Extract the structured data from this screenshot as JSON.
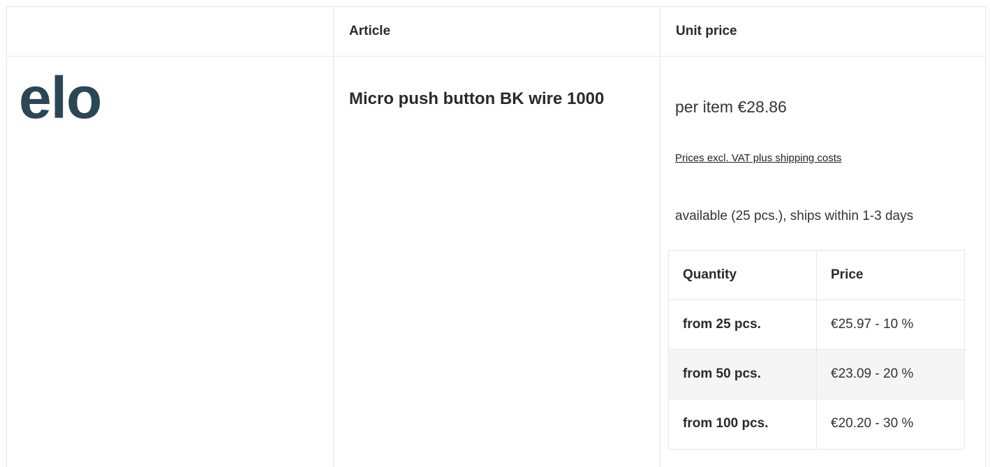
{
  "table": {
    "headers": {
      "logo_col": "",
      "article": "Article",
      "unit_price": "Unit price"
    }
  },
  "row": {
    "brand_logo": "elo",
    "product_name": "Micro push button BK wire 1000",
    "price_line": "per item €28.86",
    "vat_link": "Prices excl. VAT plus shipping costs",
    "availability": "available (25 pcs.), ships within 1-3 days"
  },
  "tiers": {
    "header": {
      "quantity": "Quantity",
      "price": "Price"
    },
    "rows": [
      {
        "quantity": "from 25 pcs.",
        "price": "€25.97 - 10 %"
      },
      {
        "quantity": "from 50 pcs.",
        "price": "€23.09 - 20 %"
      },
      {
        "quantity": "from 100 pcs.",
        "price": "€20.20 - 30 %"
      }
    ]
  },
  "colors": {
    "logo": "#2b4756",
    "border": "#e6e6e6",
    "shaded_row": "#f5f5f5"
  }
}
